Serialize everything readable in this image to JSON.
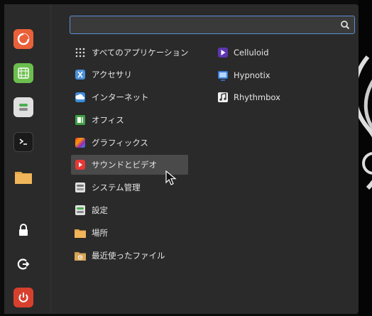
{
  "search": {
    "placeholder": "",
    "value": ""
  },
  "favorites": [
    {
      "name": "firefox-icon"
    },
    {
      "name": "calculator-icon"
    },
    {
      "name": "settings-icon"
    },
    {
      "name": "terminal-icon"
    },
    {
      "name": "folder-icon"
    }
  ],
  "session": [
    {
      "name": "lock-icon"
    },
    {
      "name": "logout-icon"
    },
    {
      "name": "power-icon"
    }
  ],
  "categories": [
    {
      "label": "すべてのアプリケーション",
      "icon": "grid-icon"
    },
    {
      "label": "アクセサリ",
      "icon": "accessories-icon"
    },
    {
      "label": "インターネット",
      "icon": "internet-icon"
    },
    {
      "label": "オフィス",
      "icon": "office-icon"
    },
    {
      "label": "グラフィックス",
      "icon": "graphics-icon"
    },
    {
      "label": "サウンドとビデオ",
      "icon": "sound-video-icon"
    },
    {
      "label": "システム管理",
      "icon": "system-admin-icon"
    },
    {
      "label": "設定",
      "icon": "settings-icon"
    },
    {
      "label": "場所",
      "icon": "places-folder-icon"
    },
    {
      "label": "最近使ったファイル",
      "icon": "recent-files-icon"
    }
  ],
  "selected_category": "サウンドとビデオ",
  "apps": [
    {
      "label": "Celluloid",
      "icon": "celluloid-icon"
    },
    {
      "label": "Hypnotix",
      "icon": "hypnotix-icon"
    },
    {
      "label": "Rhythmbox",
      "icon": "rhythmbox-icon"
    }
  ],
  "colors": {
    "panel": "#2a2a2a",
    "accent": "#5a8fd6",
    "selected": "#4a4a4a",
    "text": "#e6e6e6"
  }
}
